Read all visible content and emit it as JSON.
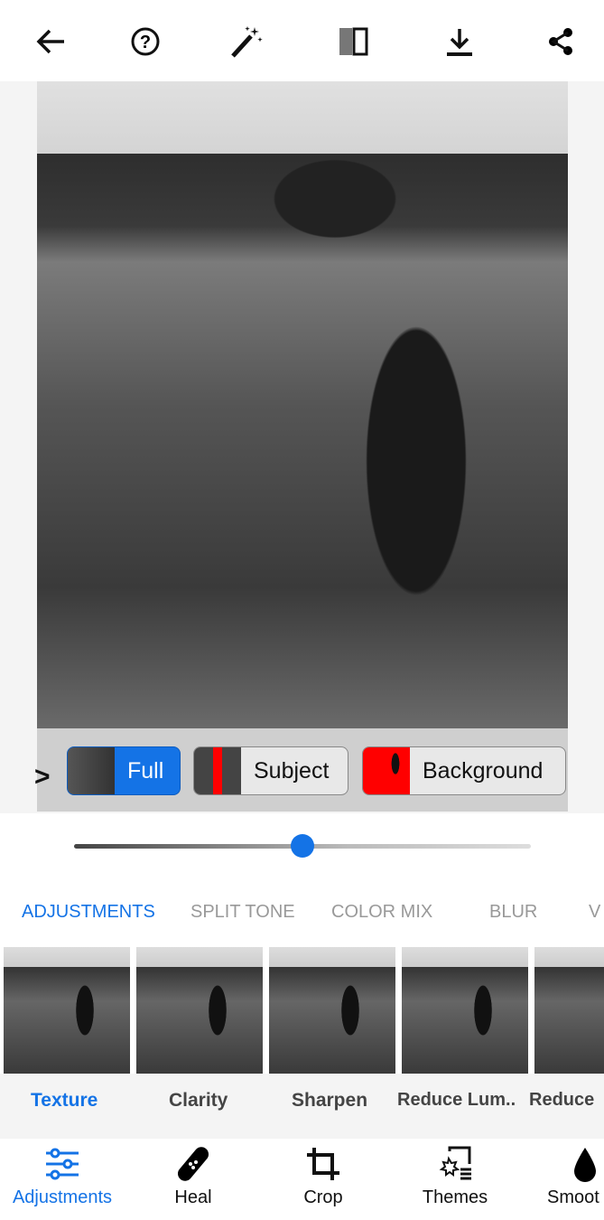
{
  "toolbar": {
    "icons": [
      "arrow-left-icon",
      "help-icon",
      "magic-wand-icon",
      "compare-icon",
      "download-icon",
      "share-icon"
    ]
  },
  "masks": {
    "items": [
      {
        "label": "Full",
        "active": true
      },
      {
        "label": "Subject",
        "active": false
      },
      {
        "label": "Background",
        "active": false
      }
    ]
  },
  "slider": {
    "value": 0.5,
    "color": "#1473e6"
  },
  "tabs": [
    {
      "label": "ADJUSTMENTS",
      "active": true
    },
    {
      "label": "SPLIT TONE"
    },
    {
      "label": "COLOR MIX"
    },
    {
      "label": "BLUR"
    },
    {
      "label": "V"
    }
  ],
  "tools": [
    {
      "label": "Texture",
      "active": true
    },
    {
      "label": "Clarity"
    },
    {
      "label": "Sharpen"
    },
    {
      "label": "Reduce Lum.."
    },
    {
      "label": "Reduce"
    }
  ],
  "nav": [
    {
      "label": "Adjustments",
      "active": true
    },
    {
      "label": "Heal"
    },
    {
      "label": "Crop"
    },
    {
      "label": "Themes"
    },
    {
      "label": "Smoot"
    }
  ],
  "accent": "#1473e6"
}
